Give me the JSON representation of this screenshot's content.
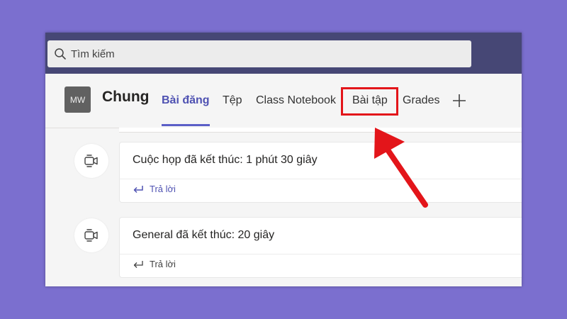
{
  "search": {
    "placeholder": "Tìm kiếm"
  },
  "header": {
    "avatar_initials": "MW",
    "team_name": "Chung",
    "tabs": [
      {
        "label": "Bài đăng",
        "active": true
      },
      {
        "label": "Tệp",
        "active": false
      },
      {
        "label": "Class Notebook",
        "active": false
      },
      {
        "label": "Bài tập",
        "active": false
      },
      {
        "label": "Grades",
        "active": false
      }
    ],
    "add_tab_icon": "plus-icon"
  },
  "posts": [
    {
      "icon": "video-meeting-icon",
      "title": "Cuộc họp đã kết thúc: 1 phút 30 giây",
      "reply_label": "Trả lời"
    },
    {
      "icon": "video-meeting-icon",
      "title": "General đã kết thúc: 20 giây",
      "reply_label": "Trả lời"
    }
  ],
  "annotation": {
    "highlight_color": "#e3151a",
    "arrow_color": "#e3151a"
  },
  "colors": {
    "background": "#7b6fcf",
    "topbar": "#464775",
    "accent": "#5b5fc7"
  }
}
